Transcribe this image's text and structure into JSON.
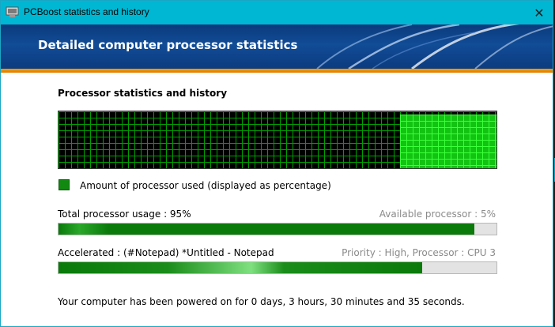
{
  "window": {
    "title": "PCBoost statistics and history",
    "accent_color": "#00b7d3"
  },
  "banner": {
    "title": "Detailed computer processor statistics"
  },
  "history": {
    "section_title": "Processor statistics and history",
    "current_usage_fraction": 0.95,
    "legend_label": "Amount of processor used (displayed as percentage)"
  },
  "total_usage": {
    "label": "Total processor usage : 95%",
    "available_label": "Available processor : 5%",
    "percent": 95
  },
  "accelerated": {
    "label": "Accelerated : (#Notepad) *Untitled - Notepad",
    "detail": "Priority : High, Processor : CPU 3",
    "percent": 83
  },
  "footer": {
    "uptime_text": "Your computer has been powered on for 0 days, 3 hours, 30 minutes and 35 seconds."
  }
}
